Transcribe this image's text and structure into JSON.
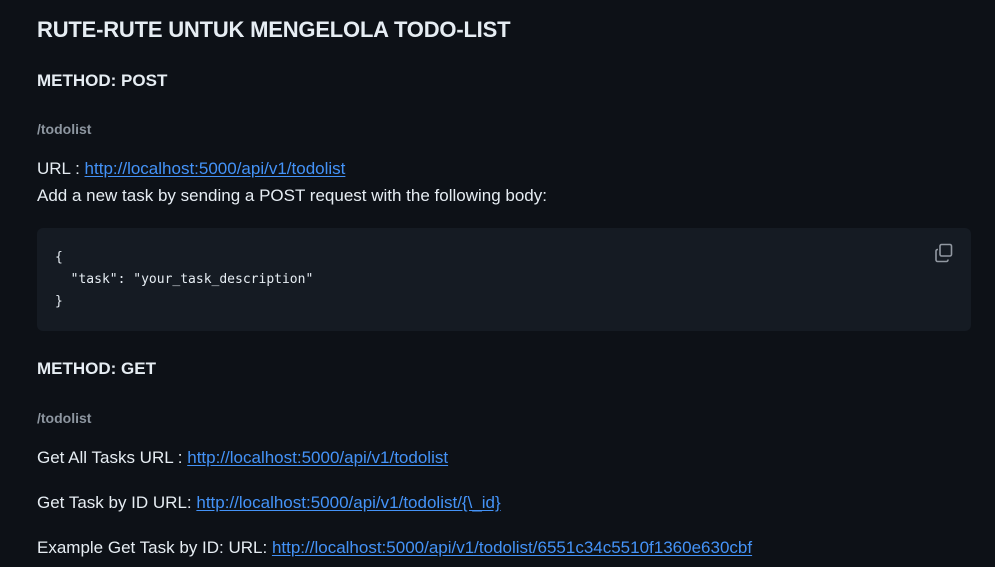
{
  "title": "RUTE-RUTE UNTUK MENGELOLA TODO-LIST",
  "post": {
    "heading": "METHOD: POST",
    "path": "/todolist",
    "url_label": "URL : ",
    "url": "http://localhost:5000/api/v1/todolist",
    "description": "Add a new task by sending a POST request with the following body:",
    "code": "{\n  \"task\": \"your_task_description\"\n}",
    "copy_icon": "copy-icon"
  },
  "get": {
    "heading": "METHOD: GET",
    "path": "/todolist",
    "all_label": "Get All Tasks URL : ",
    "all_url": "http://localhost:5000/api/v1/todolist",
    "by_id_label": "Get Task by ID URL: ",
    "by_id_url": "http://localhost:5000/api/v1/todolist/{\\_id}",
    "example_label": "Example Get Task by ID: URL: ",
    "example_url": "http://localhost:5000/api/v1/todolist/6551c34c5510f1360e630cbf"
  },
  "colors": {
    "background": "#0d1117",
    "text": "#e6edf3",
    "muted": "#8d96a0",
    "link": "#4493f8",
    "code_bg": "#151b23"
  }
}
